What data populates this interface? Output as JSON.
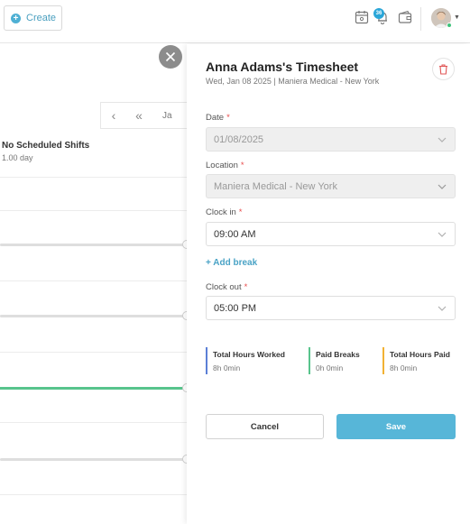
{
  "topbar": {
    "create_label": "Create",
    "notif_count": "36"
  },
  "schedule": {
    "jan_label": "Ja",
    "shift_title": "No Scheduled Shifts",
    "shift_sub": "1.00 day"
  },
  "timesheet": {
    "title": "Anna Adams's Timesheet",
    "subtitle": "Wed, Jan 08 2025 | Maniera Medical - New York",
    "date": {
      "label": "Date",
      "value": "01/08/2025"
    },
    "location": {
      "label": "Location",
      "value": "Maniera Medical - New York"
    },
    "clock_in": {
      "label": "Clock in",
      "value": "09:00 AM"
    },
    "add_break": "+ Add break",
    "clock_out": {
      "label": "Clock out",
      "value": "05:00 PM"
    },
    "summary": [
      {
        "label": "Total Hours Worked",
        "value": "8h 0min",
        "color": "#5b7fd6"
      },
      {
        "label": "Paid Breaks",
        "value": "0h 0min",
        "color": "#58c48c"
      },
      {
        "label": "Total Hours Paid",
        "value": "8h 0min",
        "color": "#f2b233"
      }
    ],
    "cancel_label": "Cancel",
    "save_label": "Save"
  }
}
